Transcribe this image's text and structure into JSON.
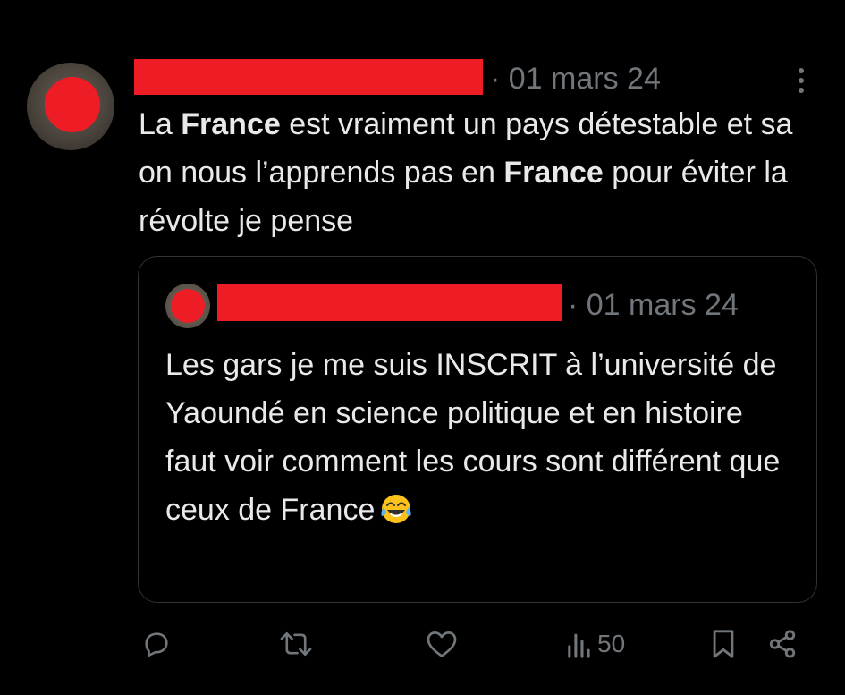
{
  "tweet": {
    "author_redacted": true,
    "meta": "· 01 mars 24",
    "text_parts": [
      {
        "t": "La ",
        "b": false
      },
      {
        "t": "France",
        "b": true
      },
      {
        "t": " est vraiment un pays détestable et sa on nous l’apprends pas en ",
        "b": false
      },
      {
        "t": "France",
        "b": true
      },
      {
        "t": " pour éviter la révolte je pense",
        "b": false
      }
    ]
  },
  "quote": {
    "author_redacted": true,
    "meta": "· 01 mars 24",
    "text": "Les gars je me suis INSCRIT à l’université de Yaoundé en science politique et en histoire faut voir comment les cours sont différent que ceux de France",
    "emoji": "face-with-tears-of-joy"
  },
  "actions": {
    "views_count": "50"
  },
  "colors": {
    "background": "#000000",
    "text": "#e7e9ea",
    "muted": "#71767b",
    "border": "#2f3336",
    "redaction": "#ee1c25"
  }
}
